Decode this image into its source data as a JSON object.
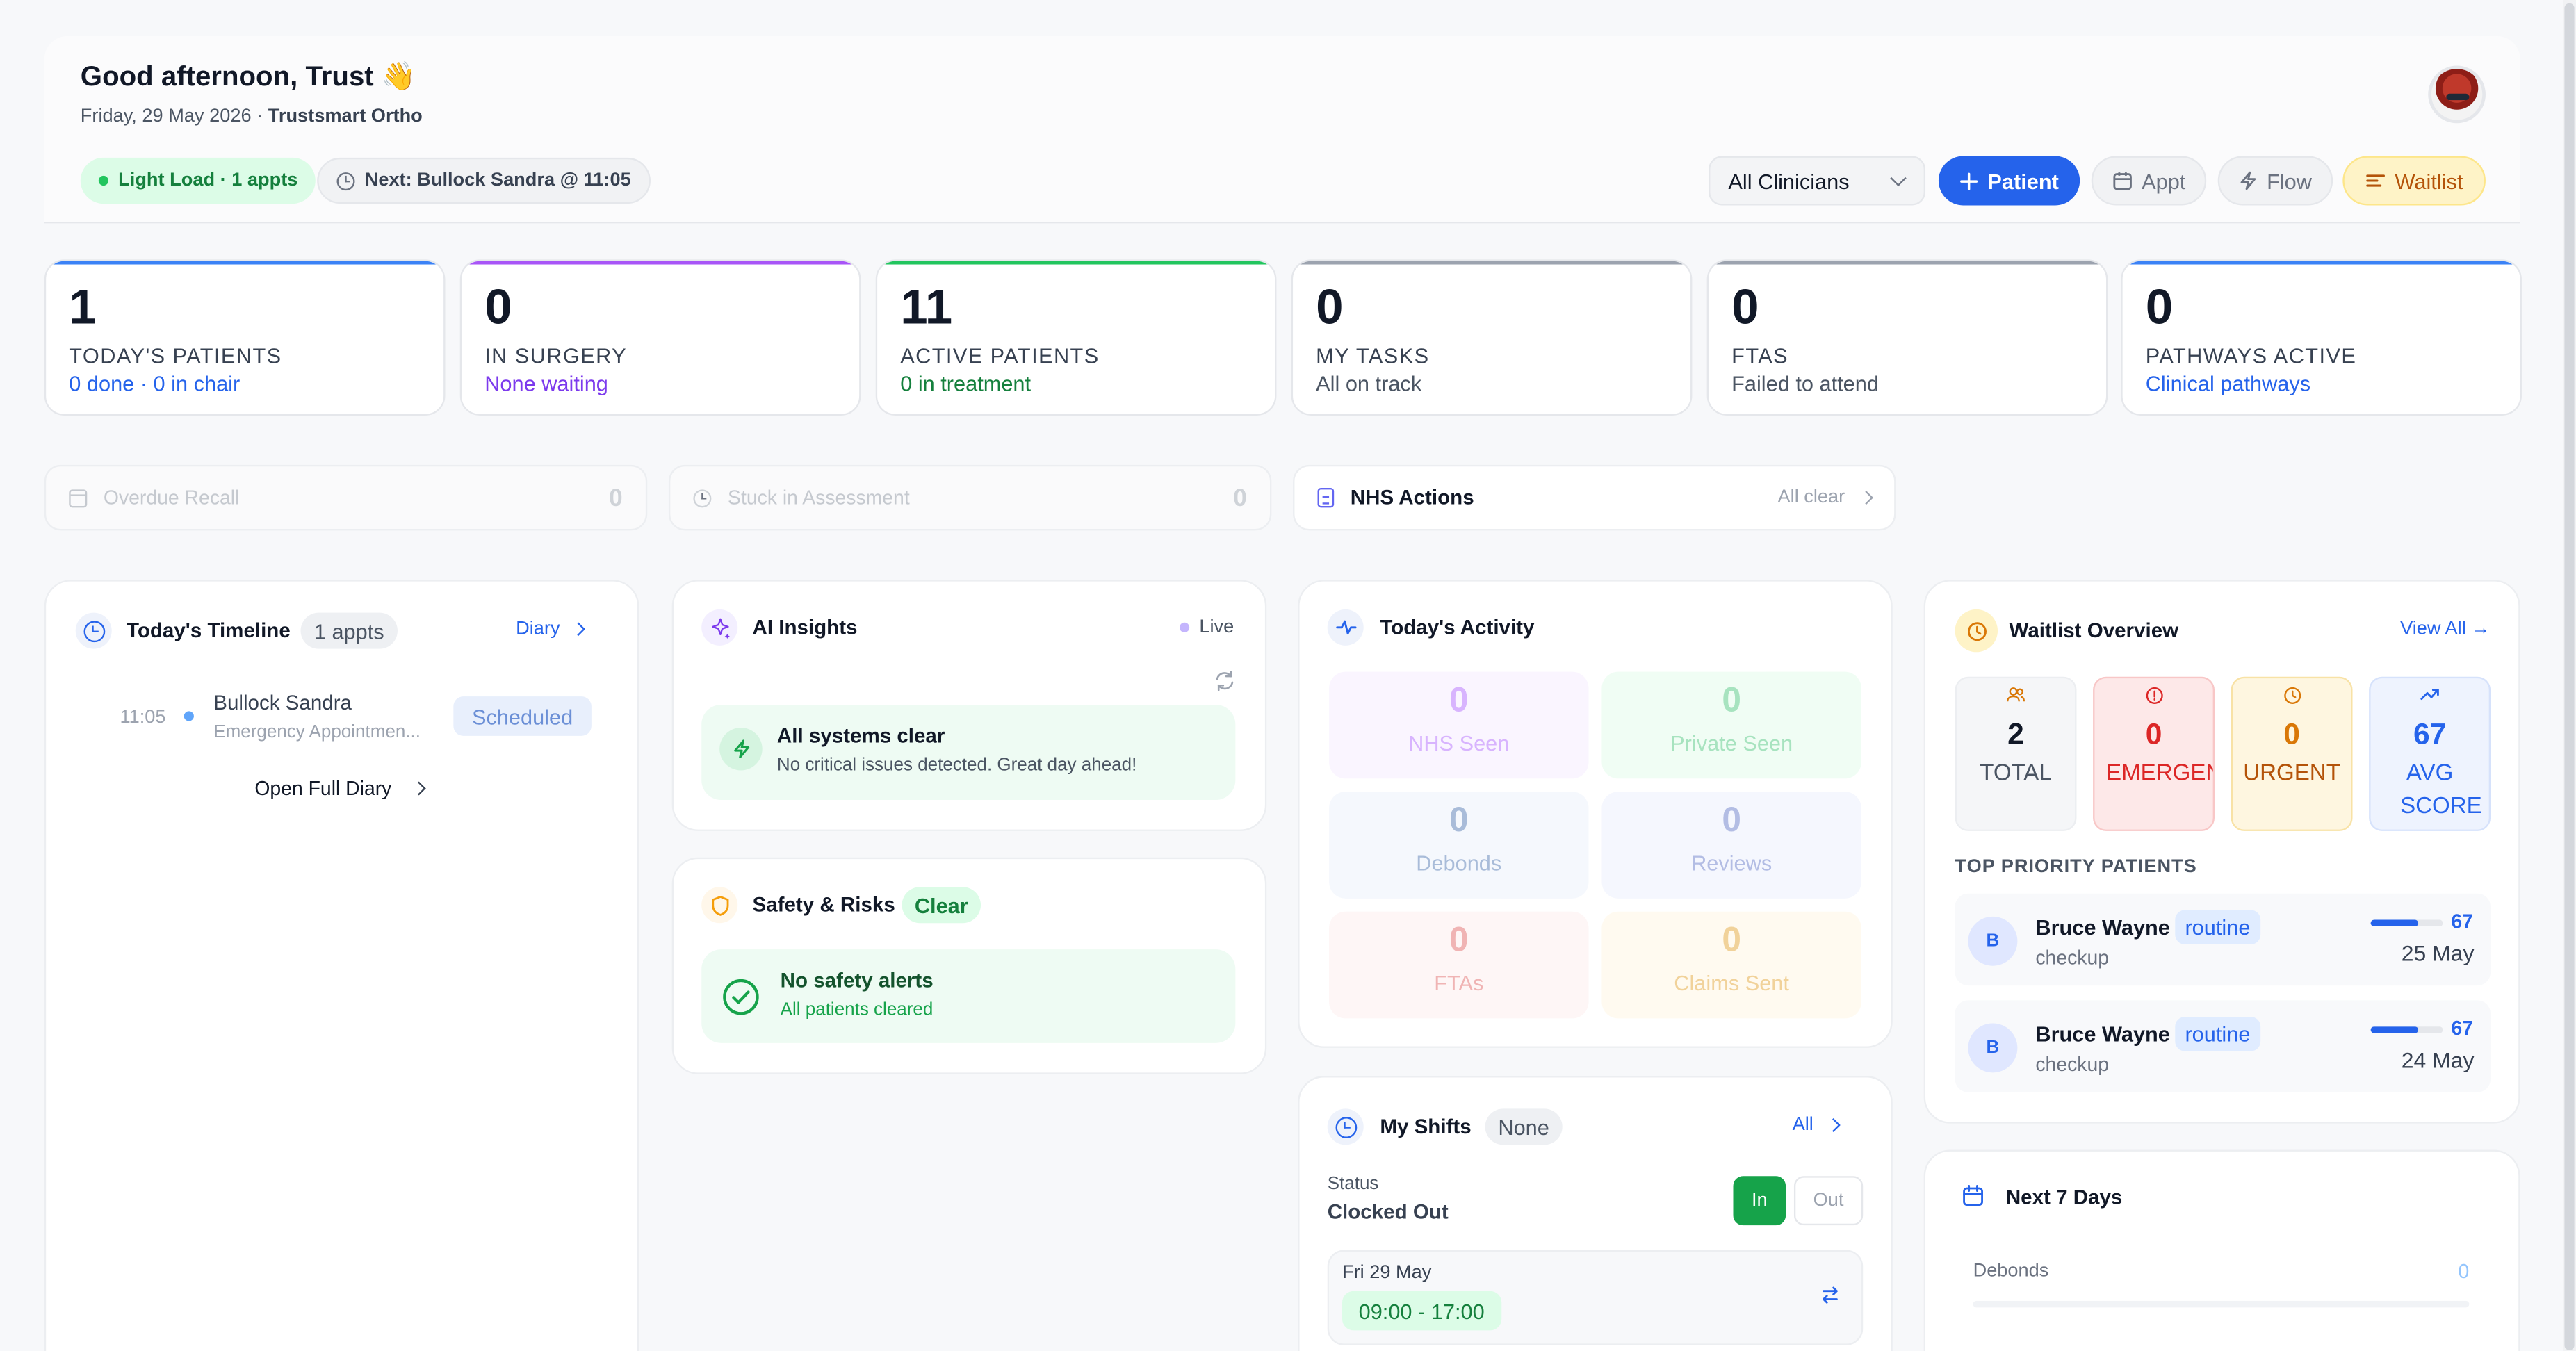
{
  "header": {
    "greeting": "Good afternoon, Trust 👋",
    "date": "Friday, 29 May 2026",
    "separator": " · ",
    "practice": "Trustsmart Ortho",
    "load_pill": "Light Load · 1 appts",
    "next_pill": "Next: Bullock Sandra @ 11:05",
    "clinician_select": "All Clinicians",
    "buttons": {
      "patient": "Patient",
      "appt": "Appt",
      "flow": "Flow",
      "waitlist": "Waitlist"
    }
  },
  "stats": [
    {
      "value": "1",
      "label": "TODAY'S PATIENTS",
      "sub": "0 done · 0 in chair",
      "accent": "#3b82f6",
      "sub_color": "#2563eb"
    },
    {
      "value": "0",
      "label": "IN SURGERY",
      "sub": "None waiting",
      "accent": "#a855f7",
      "sub_color": "#7c3aed"
    },
    {
      "value": "11",
      "label": "ACTIVE PATIENTS",
      "sub": "0 in treatment",
      "accent": "#22c55e",
      "sub_color": "#15803d"
    },
    {
      "value": "0",
      "label": "MY TASKS",
      "sub": "All on track",
      "accent": "#9ca3af",
      "sub_color": "#4b5563"
    },
    {
      "value": "0",
      "label": "FTAS",
      "sub": "Failed to attend",
      "accent": "#9ca3af",
      "sub_color": "#4b5563"
    },
    {
      "value": "0",
      "label": "PATHWAYS ACTIVE",
      "sub": "Clinical pathways",
      "accent": "#3b82f6",
      "sub_color": "#2563eb"
    }
  ],
  "strips": {
    "overdue_label": "Overdue Recall",
    "overdue_count": "0",
    "stuck_label": "Stuck in Assessment",
    "stuck_count": "0",
    "nhs_label": "NHS Actions",
    "nhs_status": "All clear"
  },
  "timeline": {
    "title": "Today's Timeline",
    "count_badge": "1 appts",
    "diary_link": "Diary",
    "items": [
      {
        "time": "11:05",
        "name": "Bullock Sandra",
        "type": "Emergency Appointmen...",
        "status": "Scheduled"
      }
    ],
    "open_diary": "Open Full Diary"
  },
  "ai_insights": {
    "title": "AI Insights",
    "live": "Live",
    "status_title": "All systems clear",
    "status_body": "No critical issues detected. Great day ahead!"
  },
  "safety": {
    "title": "Safety & Risks",
    "badge": "Clear",
    "status_title": "No safety alerts",
    "status_body": "All patients cleared"
  },
  "activity": {
    "title": "Today's Activity",
    "tiles": [
      {
        "value": "0",
        "label": "NHS Seen",
        "bg": "#faf5ff",
        "color": "#d8b4fe"
      },
      {
        "value": "0",
        "label": "Private Seen",
        "bg": "#f0fdf4",
        "color": "#a7e3bf"
      },
      {
        "value": "0",
        "label": "Debonds",
        "bg": "#f5f8fd",
        "color": "#a9bcd9"
      },
      {
        "value": "0",
        "label": "Reviews",
        "bg": "#f5f7fe",
        "color": "#b3bde4"
      },
      {
        "value": "0",
        "label": "FTAs",
        "bg": "#fef6f6",
        "color": "#f0b4b4"
      },
      {
        "value": "0",
        "label": "Claims Sent",
        "bg": "#fffaf0",
        "color": "#f1d29a"
      }
    ]
  },
  "shifts": {
    "title": "My Shifts",
    "badge": "None",
    "all_link": "All",
    "status_label": "Status",
    "status_value": "Clocked Out",
    "in_button": "In",
    "out_button": "Out",
    "shift_date": "Fri 29 May",
    "shift_time": "09:00 - 17:00"
  },
  "waitlist": {
    "title": "Waitlist Overview",
    "view_all": "View All →",
    "boxes": [
      {
        "value": "2",
        "label": "TOTAL",
        "icon": "users-icon",
        "bg": "#f5f6f8",
        "border": "#eceef1",
        "color": "#111827",
        "label_color": "#4b5563"
      },
      {
        "value": "0",
        "label": "EMERGENCY",
        "icon": "alert-icon",
        "bg": "#fde8e8",
        "border": "#f8c7c7",
        "color": "#dc2626",
        "label_color": "#dc2626"
      },
      {
        "value": "0",
        "label": "URGENT",
        "icon": "clock-icon",
        "bg": "#fef6e0",
        "border": "#f8e2a6",
        "color": "#d97706",
        "label_color": "#b45309"
      },
      {
        "value": "67",
        "label": "AVG SCORE",
        "icon": "trend-up-icon",
        "bg": "#eef3fe",
        "border": "#d6e2fb",
        "color": "#2563eb",
        "label_color": "#2563eb"
      }
    ],
    "priority_heading": "TOP PRIORITY PATIENTS",
    "patients": [
      {
        "initial": "B",
        "name": "Bruce Wayne",
        "tag": "routine",
        "sub": "checkup",
        "score": 67,
        "date": "25 May"
      },
      {
        "initial": "B",
        "name": "Bruce Wayne",
        "tag": "routine",
        "sub": "checkup",
        "score": 67,
        "date": "24 May"
      }
    ]
  },
  "next7": {
    "title": "Next 7 Days",
    "rows": [
      {
        "label": "Debonds",
        "value": "0"
      }
    ]
  }
}
